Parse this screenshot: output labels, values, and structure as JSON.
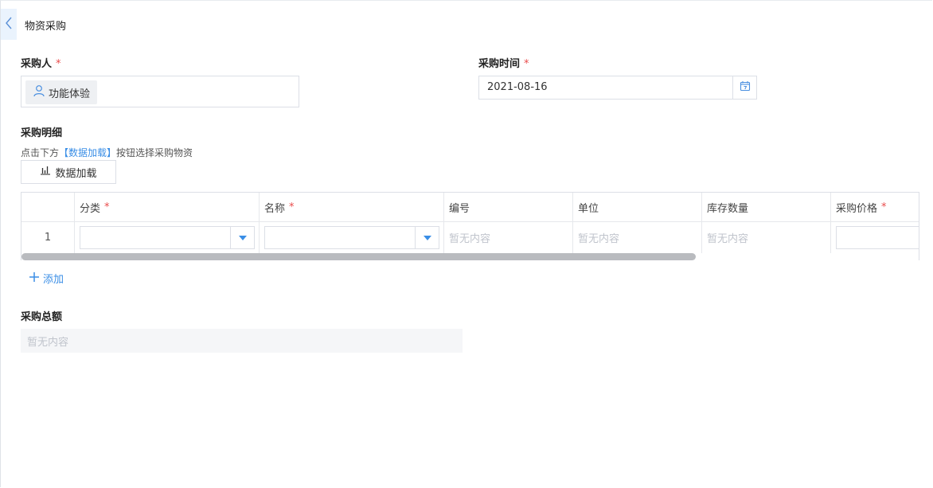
{
  "page": {
    "title": "物资采购"
  },
  "buyer": {
    "label": "采购人",
    "required_mark": "*",
    "value": "功能体验"
  },
  "purchase_time": {
    "label": "采购时间",
    "required_mark": "*",
    "value": "2021-08-16"
  },
  "details": {
    "label": "采购明细",
    "hint_prefix": "点击下方",
    "hint_link": "【数据加载】",
    "hint_suffix": "按钮选择采购物资",
    "load_button": "数据加载",
    "columns": [
      {
        "label": "分类",
        "required_mark": "*"
      },
      {
        "label": "名称",
        "required_mark": "*"
      },
      {
        "label": "编号",
        "required_mark": ""
      },
      {
        "label": "单位",
        "required_mark": ""
      },
      {
        "label": "库存数量",
        "required_mark": ""
      },
      {
        "label": "采购价格",
        "required_mark": "*"
      }
    ],
    "rows": [
      {
        "index": "1",
        "category": "",
        "name": "",
        "code": "暂无内容",
        "unit": "暂无内容",
        "stock": "暂无内容",
        "price": ""
      }
    ],
    "add_button": "添加"
  },
  "total": {
    "label": "采购总额",
    "placeholder": "暂无内容"
  },
  "colors": {
    "accent": "#3a8ee6",
    "required": "#e94b4b",
    "placeholder": "#c0c4cc"
  },
  "icons": [
    "chevron-left-icon",
    "user-icon",
    "calendar-icon",
    "bar-chart-icon",
    "caret-down-icon",
    "plus-icon"
  ]
}
